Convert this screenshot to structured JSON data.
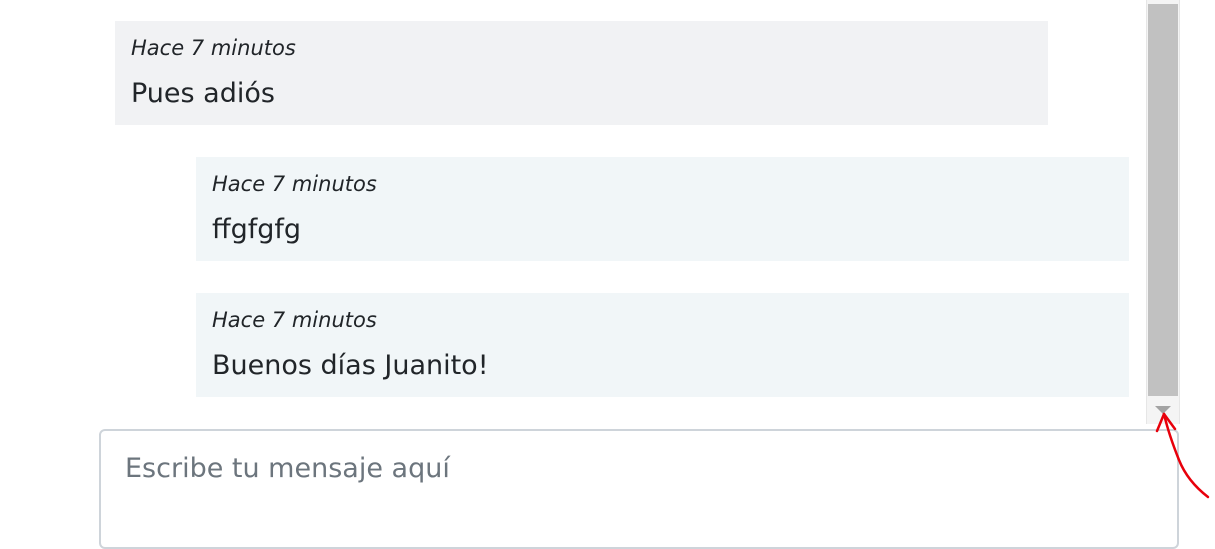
{
  "messages": [
    {
      "direction": "received",
      "time": "Hace 7 minutos",
      "text": "Pues adiós"
    },
    {
      "direction": "sent",
      "time": "Hace 7 minutos",
      "text": "ffgfgfg"
    },
    {
      "direction": "sent",
      "time": "Hace 7 minutos",
      "text": "Buenos días Juanito!"
    }
  ],
  "composer": {
    "placeholder": "Escribe tu mensaje aquí",
    "value": ""
  },
  "colors": {
    "received_bubble": "#f1f2f4",
    "sent_bubble": "#f1f6f8",
    "scrollbar_thumb": "#c1c1c1",
    "annotation": "#e8000b"
  },
  "annotation": {
    "icon": "red-hand-drawn-arrow-icon"
  }
}
